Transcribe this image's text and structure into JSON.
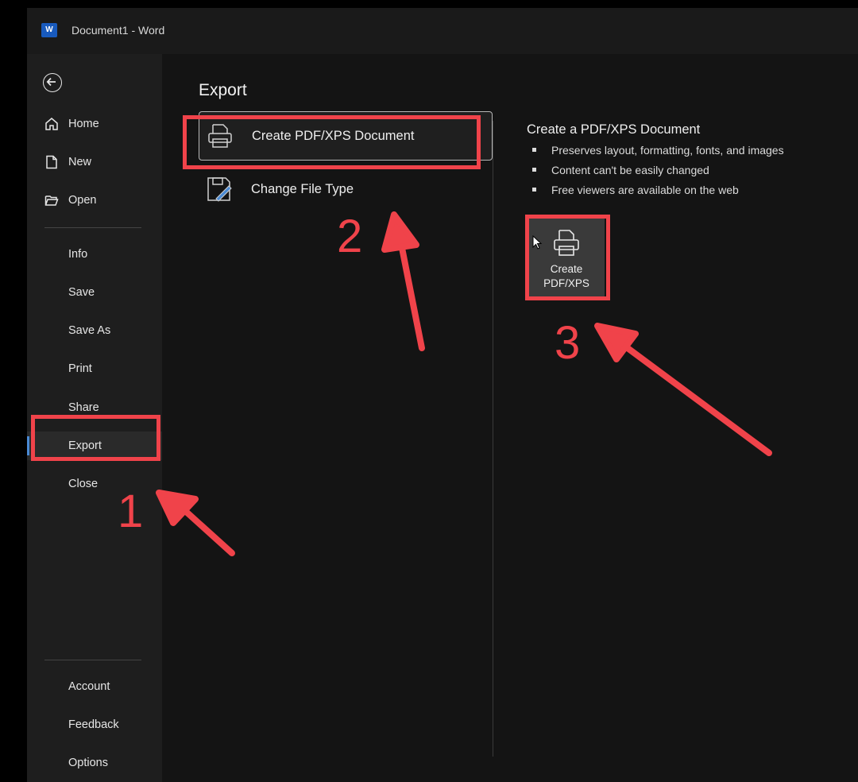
{
  "titlebar": {
    "doc_title": "Document1  -  Word",
    "app_logo_letter": "W"
  },
  "sidebar": {
    "items": [
      {
        "label": "Home",
        "icon": "home-icon"
      },
      {
        "label": "New",
        "icon": "new-document-icon"
      },
      {
        "label": "Open",
        "icon": "folder-open-icon"
      },
      {
        "label": "Info"
      },
      {
        "label": "Save"
      },
      {
        "label": "Save As"
      },
      {
        "label": "Print"
      },
      {
        "label": "Share"
      },
      {
        "label": "Export",
        "active": true
      },
      {
        "label": "Close"
      },
      {
        "label": "Account"
      },
      {
        "label": "Feedback"
      },
      {
        "label": "Options"
      }
    ]
  },
  "main": {
    "title": "Export",
    "options": [
      {
        "label": "Create PDF/XPS Document",
        "icon": "pdf-printer-icon",
        "selected": true
      },
      {
        "label": "Change File Type",
        "icon": "change-file-type-icon"
      }
    ],
    "detail": {
      "title": "Create a PDF/XPS Document",
      "bullets": [
        "Preserves layout, formatting, fonts, and images",
        "Content can't be easily changed",
        "Free viewers are available on the web"
      ],
      "button_label": "Create\nPDF/XPS",
      "button_icon": "pdf-printer-icon"
    }
  },
  "annotations": {
    "color": "#f0434a",
    "steps": [
      "1",
      "2",
      "3"
    ]
  },
  "colors": {
    "window_bg": "#141414",
    "sidebar_bg": "#1e1e1e",
    "accent": "#4a8ad4",
    "word_blue": "#185abd"
  }
}
